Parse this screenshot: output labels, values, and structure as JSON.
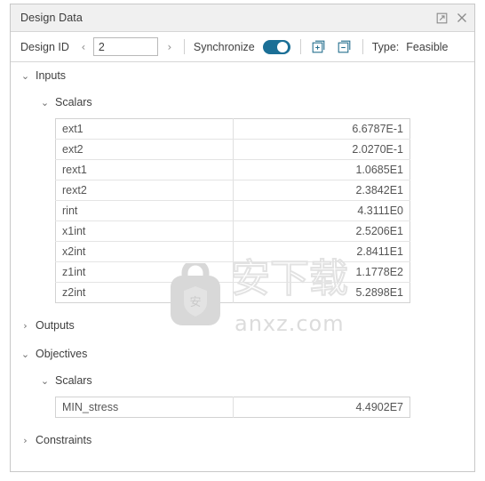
{
  "window": {
    "title": "Design Data",
    "actions": [
      {
        "name": "undock-icon",
        "label": "Undock"
      },
      {
        "name": "close-icon",
        "label": "Close"
      }
    ]
  },
  "toolbar": {
    "design_id_label": "Design ID",
    "prev_arrow": "‹",
    "next_arrow": "›",
    "design_id_value": "2",
    "design_id_placeholder": "",
    "synchronize_label": "Synchronize",
    "synchronize_on": true,
    "expand_all_label": "Expand All",
    "collapse_all_label": "Collapse All",
    "type_label": "Type:",
    "type_value": "Feasible"
  },
  "tree": {
    "chevron_expanded": "⌄",
    "chevron_collapsed": "›",
    "inputs": {
      "label": "Inputs",
      "expanded": true,
      "scalars": {
        "label": "Scalars",
        "expanded": true,
        "rows": [
          {
            "name": "ext1",
            "value": "6.6787E-1"
          },
          {
            "name": "ext2",
            "value": "2.0270E-1"
          },
          {
            "name": "rext1",
            "value": "1.0685E1"
          },
          {
            "name": "rext2",
            "value": "2.3842E1"
          },
          {
            "name": "rint",
            "value": "4.3111E0"
          },
          {
            "name": "x1int",
            "value": "2.5206E1"
          },
          {
            "name": "x2int",
            "value": "2.8411E1"
          },
          {
            "name": "z1int",
            "value": "1.1778E2"
          },
          {
            "name": "z2int",
            "value": "5.2898E1"
          }
        ]
      }
    },
    "outputs": {
      "label": "Outputs",
      "expanded": false
    },
    "objectives": {
      "label": "Objectives",
      "expanded": true,
      "scalars": {
        "label": "Scalars",
        "expanded": true,
        "rows": [
          {
            "name": "MIN_stress",
            "value": "4.4902E7"
          }
        ]
      }
    },
    "constraints": {
      "label": "Constraints",
      "expanded": false
    }
  },
  "watermark": {
    "cjk": "安下载",
    "site": "anxz.com",
    "badge_char": "安"
  },
  "colors": {
    "accent": "#1b6f96",
    "icon_blue": "#27708f",
    "titlebar_bg": "#f0f0f0",
    "border": "#c8c8c8",
    "text": "#3f3f3f"
  }
}
